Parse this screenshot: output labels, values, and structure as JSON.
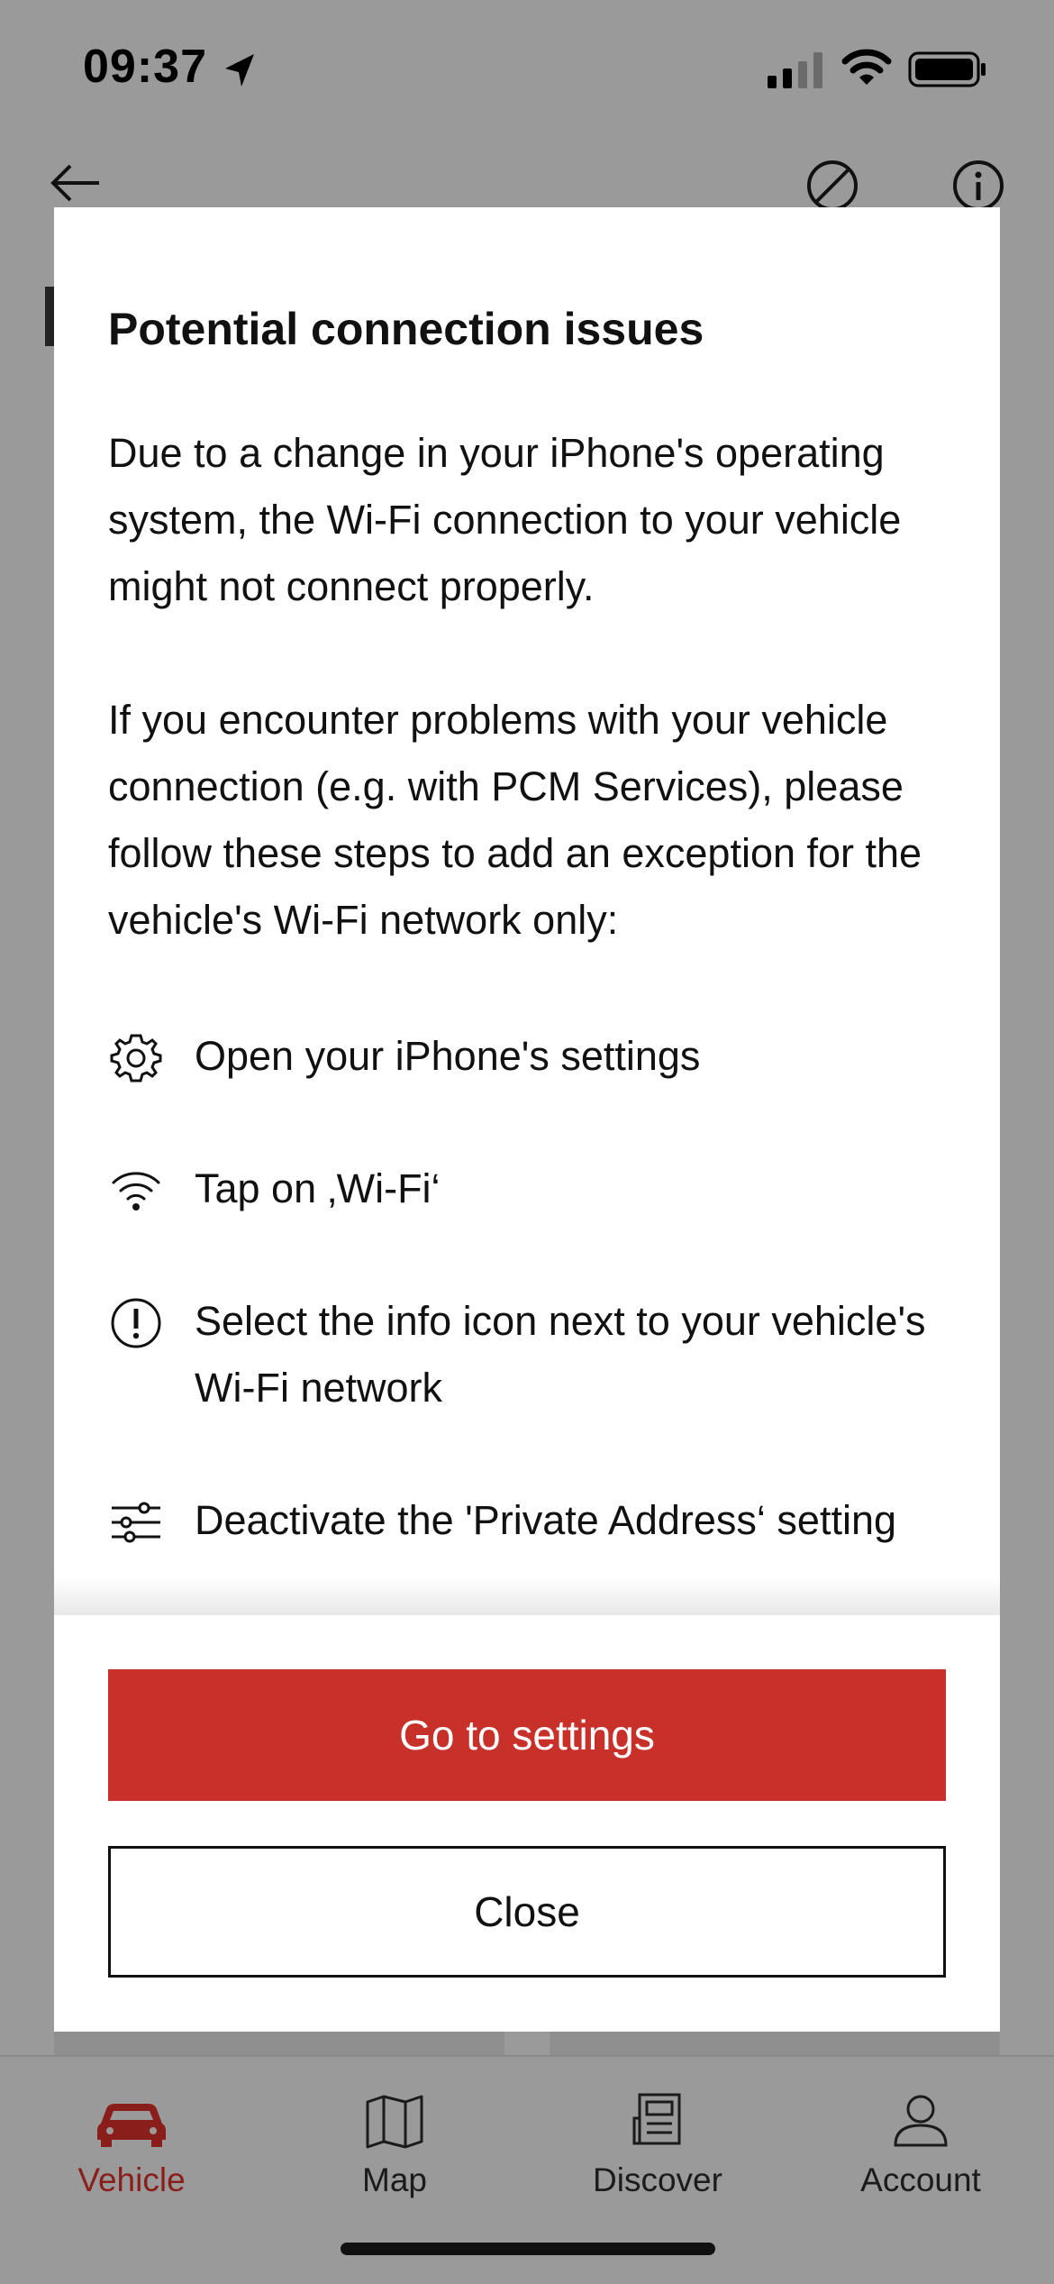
{
  "status_bar": {
    "time": "09:37",
    "icons": [
      "location-arrow-icon",
      "cellular-signal-icon",
      "wifi-icon",
      "battery-icon"
    ]
  },
  "header": {
    "icons": [
      "back-arrow-icon",
      "disable-icon",
      "info-icon"
    ]
  },
  "modal": {
    "title": "Potential connection issues",
    "paragraph_1": "Due to a change in your iPhone's operating system, the Wi-Fi connection to your vehicle might not connect properly.",
    "paragraph_2": "If you encounter problems with your vehicle connection (e.g. with PCM Services), please follow these steps to add an exception for the vehicle's Wi-Fi network only:",
    "steps": [
      {
        "icon": "gear-icon",
        "text": "Open your iPhone's settings"
      },
      {
        "icon": "wifi-icon",
        "text": "Tap on ‚Wi-Fi‘"
      },
      {
        "icon": "exclamation-circle-icon",
        "text": "Select the info icon next to your vehicle's Wi-Fi network"
      },
      {
        "icon": "sliders-icon",
        "text": "Deactivate the 'Private Address‘ setting"
      }
    ],
    "primary_button": "Go to settings",
    "secondary_button": "Close"
  },
  "tab_bar": {
    "tabs": [
      {
        "label": "Vehicle",
        "icon": "car-icon",
        "active": true
      },
      {
        "label": "Map",
        "icon": "map-icon",
        "active": false
      },
      {
        "label": "Discover",
        "icon": "news-icon",
        "active": false
      },
      {
        "label": "Account",
        "icon": "user-icon",
        "active": false
      }
    ]
  },
  "colors": {
    "accent_red": "#c8302a",
    "active_tab": "#8a1e1b",
    "overlay_gray": "#9a9a9a"
  }
}
